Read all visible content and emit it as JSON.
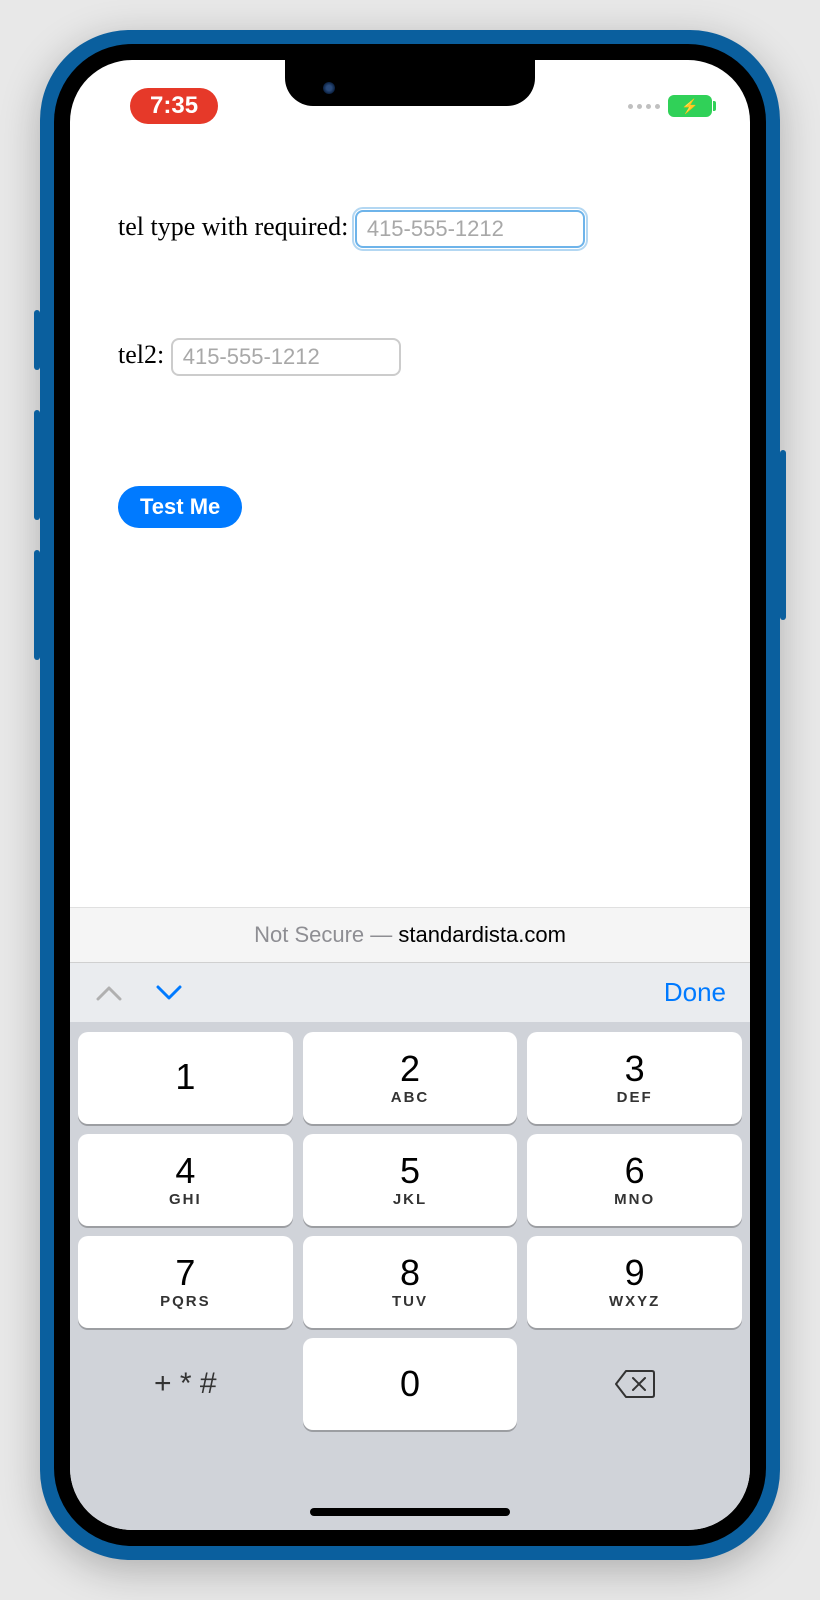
{
  "status": {
    "time": "7:35"
  },
  "form": {
    "field1": {
      "label": "tel type with required: ",
      "placeholder": "415-555-1212"
    },
    "field2": {
      "label": "tel2: ",
      "placeholder": "415-555-1212"
    },
    "button": "Test Me"
  },
  "url": {
    "prefix": "Not Secure — ",
    "domain": "standardista.com"
  },
  "toolbar": {
    "done": "Done"
  },
  "keys": {
    "k1": {
      "n": "1",
      "s": ""
    },
    "k2": {
      "n": "2",
      "s": "ABC"
    },
    "k3": {
      "n": "3",
      "s": "DEF"
    },
    "k4": {
      "n": "4",
      "s": "GHI"
    },
    "k5": {
      "n": "5",
      "s": "JKL"
    },
    "k6": {
      "n": "6",
      "s": "MNO"
    },
    "k7": {
      "n": "7",
      "s": "PQRS"
    },
    "k8": {
      "n": "8",
      "s": "TUV"
    },
    "k9": {
      "n": "9",
      "s": "WXYZ"
    },
    "k0": {
      "n": "0",
      "s": ""
    },
    "sym": "+ * #"
  }
}
